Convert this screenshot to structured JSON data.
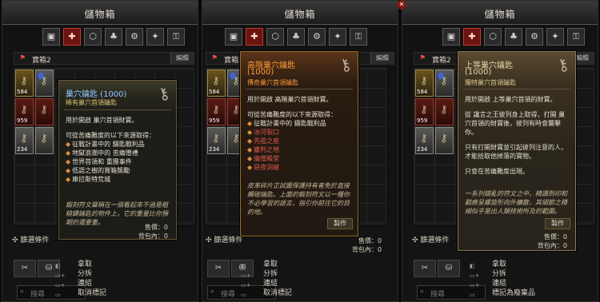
{
  "panels": [
    {
      "title": "儲物箱",
      "stash_name": "寶箱2",
      "edit_label": "編輯",
      "filter_label": "篩選條件",
      "search_placeholder": "搜尋",
      "counts": [
        "584",
        "959",
        "234",
        "1000"
      ],
      "tooltip": {
        "title": "巢穴鑰匙 (1000)",
        "subtitle": "稀有巢穴首領鑰匙",
        "usage": "用於開啟 巢穴首領財寶。",
        "sources_intro": "可從苦痛難度的以下來源取得：",
        "sources": [
          "征戰計畫中的 鑄匙戰利品",
          "地獄浪潮中的 苦痛贈禮",
          "世界首領和 重團事件",
          "低語之樹的賞箱獎勵",
          "庫拉斯特荒城"
        ],
        "lore": "鍛刻符文聲稱在一個看起來不過是粗糙鑄鑰匙的物件上，它的重量比你預期的還要重。",
        "price": "售價：0",
        "bag": "背包內：0"
      },
      "context_menu": [
        "拿取",
        "分拆",
        "連結",
        "取消標記"
      ]
    },
    {
      "title": "儲物箱",
      "stash_name": "寶箱2",
      "edit_label": "編輯",
      "filter_label": "篩選條件",
      "search_placeholder": "搜尋",
      "counts": [
        "584",
        "959",
        "234",
        "1000"
      ],
      "tooltip": {
        "title": "高階巢穴鑰匙",
        "count": "(1000)",
        "subtitle": "傳奇巢穴首領鑰匙",
        "usage": "用於開啟 高階巢穴首領財寶。",
        "sources_intro": "可從苦痛難度的以下來源取得：",
        "sources": [
          "征戰計畫中的 鑄匙戰利品",
          "冰河裂口",
          "先祖之座",
          "審判之地",
          "儀僧殿堂",
          "惡夜洞窟"
        ],
        "lore": "皮革碎片正試圖保護持有者免於直接觸碰鑰匙。上面的鍛刻符文以一種你不必學習的語言，指引你前往它的目的地。",
        "craft": "製作",
        "price": "售價：0",
        "bag": "背包內：0"
      },
      "context_menu": [
        "拿取",
        "分拆",
        "連結",
        "取消標記"
      ]
    },
    {
      "title": "儲物箱",
      "stash_name": "寶箱2",
      "edit_label": "編輯",
      "filter_label": "篩選條件",
      "search_placeholder": "搜尋",
      "counts": [
        "584",
        "959",
        "234",
        "1000"
      ],
      "tooltip": {
        "title": "上等巢穴鑰匙",
        "count": "(1000)",
        "subtitle": "獨特巢穴首領鑰匙",
        "usage": "用於開啟 上等巢穴首領的財寶。",
        "sources_intro": "從 讒言之王彼列身上取得，打開 巢穴首領的財寶後，彼列有時會襲擊你。",
        "sources": [],
        "note1": "只有打開財寶並引起彼列注意的人，才能拾取他掉落的寶物。",
        "note2": "只會在苦痛難度出現。",
        "lore": "一系列錯亂的符文之中，精讀到印和戳痕呈螺旋形向外擴散，其細節之精細似乎是出人類技術所及的範圍。",
        "craft": "製作",
        "price": "售價：0",
        "bag": "背包內：0"
      },
      "context_menu": [
        "拿取",
        "分拆",
        "連結",
        "標記為廢棄品"
      ]
    }
  ],
  "colors": {
    "accent_red": "#c23a2a",
    "title_blue": "#8ec8ff",
    "source_orange": "#e08c3a"
  }
}
